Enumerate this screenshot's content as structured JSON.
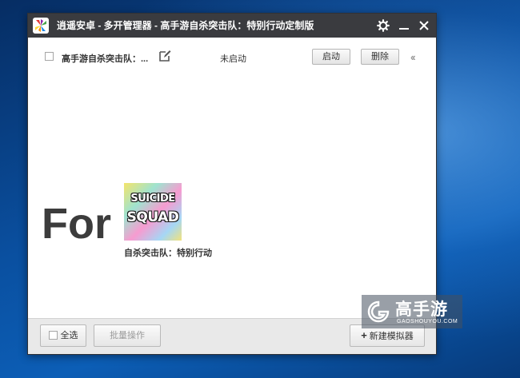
{
  "window": {
    "title": "逍遥安卓 - 多开管理器 - 高手游自杀突击队：特别行动定制版",
    "icons": {
      "app": "xiaoyao-logo-icon",
      "settings": "gear-icon",
      "minimize": "minimize-icon",
      "close": "close-icon"
    }
  },
  "emulator_list": [
    {
      "name": "高手游自杀突击队：...",
      "status": "未启动",
      "start_label": "启动",
      "delete_label": "删除",
      "icons": {
        "edit": "edit-icon",
        "collapse": "double-chevron-left-icon"
      }
    }
  ],
  "promo": {
    "for_text": "For",
    "art_line1": "SUICIDE",
    "art_line2": "SQUAD",
    "game_title": "自杀突击队：特别行动"
  },
  "bottom": {
    "select_all_label": "全选",
    "batch_label": "批量操作",
    "new_emulator_label": "新建模拟器",
    "new_icon": "plus-icon"
  },
  "watermark": {
    "text": "高手游",
    "subtext": "GAOSHOUYOU.COM"
  },
  "colors": {
    "titlebar": "#3a3b3f",
    "window_bg": "#ffffff",
    "bottombar": "#e9e9e9",
    "desktop": "#0a4f9f"
  }
}
